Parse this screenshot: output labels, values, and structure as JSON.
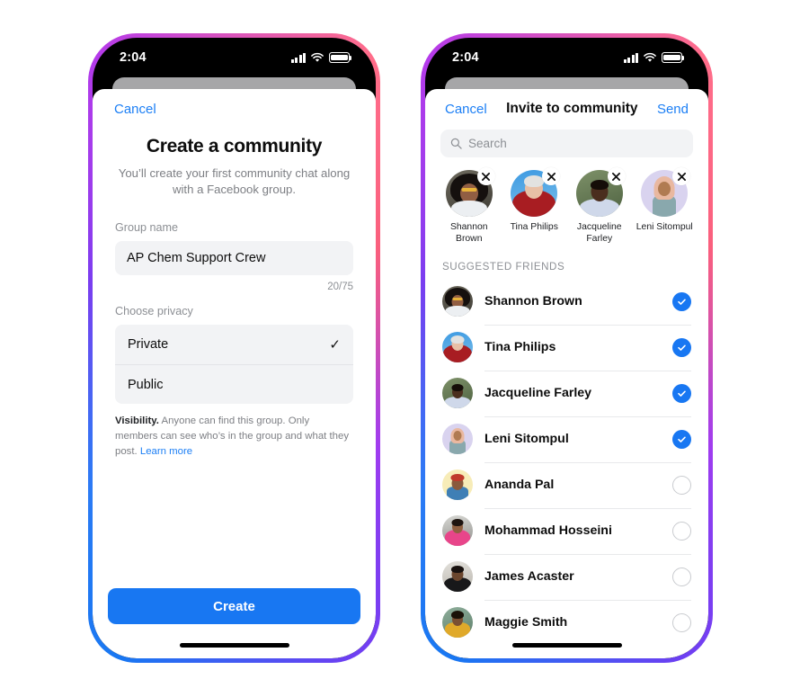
{
  "status_bar": {
    "time": "2:04",
    "signal_icon": "cellular-bars-icon",
    "wifi_icon": "wifi-icon",
    "battery_icon": "battery-icon"
  },
  "colors": {
    "accent_blue": "#1877f2",
    "link_blue": "#1c7ff5",
    "field_gray": "#f2f3f5",
    "muted_text": "#8c8f94"
  },
  "left_screen": {
    "cancel_label": "Cancel",
    "title": "Create a community",
    "subtitle": "You’ll create your first community chat along with a Facebook group.",
    "group_name_label": "Group name",
    "group_name_value": "AP Chem Support Crew",
    "group_name_placeholder": "Group name",
    "char_counter": "20/75",
    "privacy_label": "Choose privacy",
    "privacy_options": [
      {
        "label": "Private",
        "selected": true,
        "check_icon": "checkmark-icon"
      },
      {
        "label": "Public",
        "selected": false
      }
    ],
    "visibility_bold": "Visibility.",
    "visibility_text": " Anyone can find this group. Only members can see who’s in the group and what they post. ",
    "visibility_link": "Learn more",
    "create_label": "Create"
  },
  "right_screen": {
    "cancel_label": "Cancel",
    "title": "Invite to community",
    "send_label": "Send",
    "search_placeholder": "Search",
    "search_icon": "search-icon",
    "selected_chips": [
      {
        "name": "Shannon Brown",
        "remove_icon": "close-icon"
      },
      {
        "name": "Tina Philips",
        "remove_icon": "close-icon"
      },
      {
        "name": "Jacqueline Farley",
        "remove_icon": "close-icon"
      },
      {
        "name": "Leni Sitompul",
        "remove_icon": "close-icon"
      }
    ],
    "section_title": "Suggested friends",
    "friends": [
      {
        "name": "Shannon Brown",
        "selected": true
      },
      {
        "name": "Tina Philips",
        "selected": true
      },
      {
        "name": "Jacqueline Farley",
        "selected": true
      },
      {
        "name": "Leni Sitompul",
        "selected": true
      },
      {
        "name": "Ananda Pal",
        "selected": false
      },
      {
        "name": "Mohammad Hosseini",
        "selected": false
      },
      {
        "name": "James Acaster",
        "selected": false
      },
      {
        "name": "Maggie Smith",
        "selected": false
      }
    ]
  }
}
